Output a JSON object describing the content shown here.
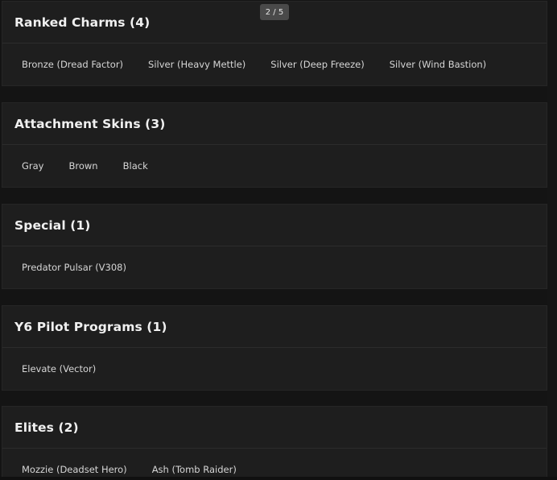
{
  "page_indicator": "2 / 5",
  "sections": [
    {
      "title": "Ranked Charms (4)",
      "items": [
        "Bronze (Dread Factor)",
        "Silver (Heavy Mettle)",
        "Silver (Deep Freeze)",
        "Silver (Wind Bastion)"
      ]
    },
    {
      "title": "Attachment Skins (3)",
      "items": [
        "Gray",
        "Brown",
        "Black"
      ]
    },
    {
      "title": "Special (1)",
      "items": [
        "Predator Pulsar (V308)"
      ]
    },
    {
      "title": "Y6 Pilot Programs (1)",
      "items": [
        "Elevate (Vector)"
      ]
    },
    {
      "title": "Elites (2)",
      "items": [
        "Mozzie (Deadset Hero)",
        "Ash (Tomb Raider)"
      ]
    }
  ]
}
